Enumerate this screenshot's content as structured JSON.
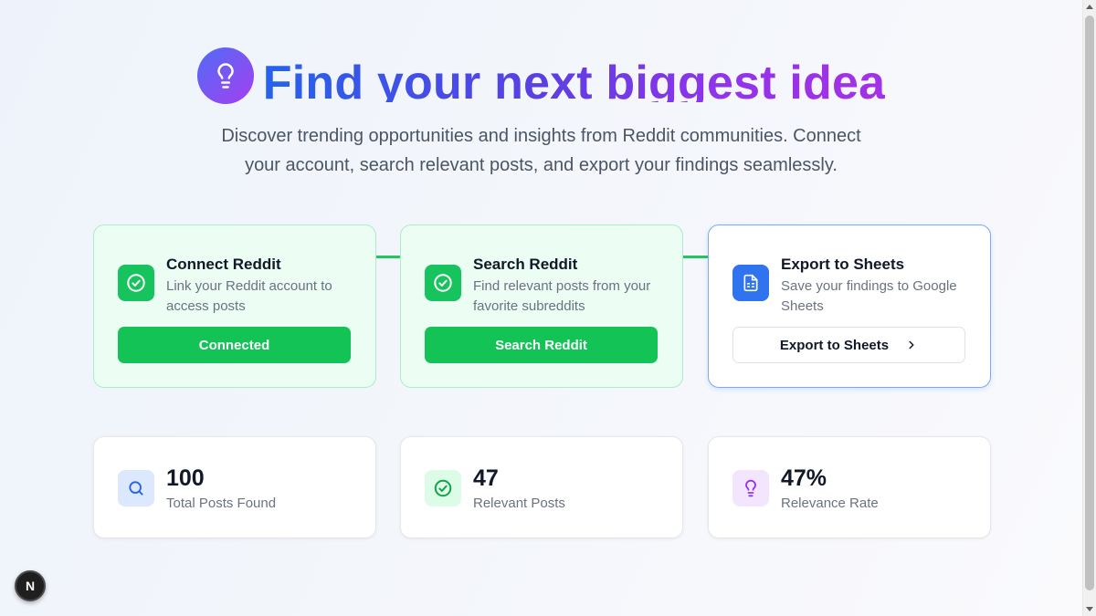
{
  "hero": {
    "title": "Find your next biggest idea",
    "icon": "lightbulb-icon",
    "subtitle": "Discover trending opportunities and insights from Reddit communities. Connect your account, search relevant posts, and export your findings seamlessly."
  },
  "steps": [
    {
      "title": "Connect Reddit",
      "description": "Link your Reddit account to access posts",
      "button": "Connected",
      "icon": "check-circle-icon",
      "status": "complete"
    },
    {
      "title": "Search Reddit",
      "description": "Find relevant posts from your favorite subreddits",
      "button": "Search Reddit",
      "icon": "check-circle-icon",
      "status": "complete"
    },
    {
      "title": "Export to Sheets",
      "description": "Save your findings to Google Sheets",
      "button": "Export to Sheets",
      "icon": "spreadsheet-icon",
      "status": "active"
    }
  ],
  "stats": [
    {
      "value": "100",
      "label": "Total Posts Found",
      "icon": "search-icon"
    },
    {
      "value": "47",
      "label": "Relevant Posts",
      "icon": "check-circle-icon"
    },
    {
      "value": "47%",
      "label": "Relevance Rate",
      "icon": "lightbulb-icon"
    }
  ],
  "badge": {
    "label": "N"
  },
  "colors": {
    "accent_green": "#13c356",
    "accent_blue": "#2f73ee",
    "accent_purple": "#9333ea"
  }
}
